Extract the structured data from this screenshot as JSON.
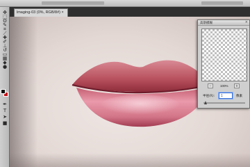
{
  "app": {
    "document_tab": "lmaging-03 (0%, RGB/8#) ×",
    "tab_close": "×"
  },
  "tools": [
    "move-tool-icon",
    "marquee-tool-icon",
    "lasso-tool-icon",
    "quick-select-icon",
    "crop-tool-icon",
    "eyedropper-icon",
    "healing-brush-icon",
    "brush-tool-icon",
    "clone-stamp-icon",
    "history-brush-icon",
    "eraser-icon",
    "gradient-icon",
    "blur-tool-icon",
    "dodge-tool-icon",
    "pen-tool-icon",
    "type-tool-icon",
    "path-select-icon",
    "shape-tool-icon"
  ],
  "colors": {
    "foreground": "#101010",
    "background": "#c4121a",
    "lip_upper": "#b8505d",
    "lip_lower": "#d8788a",
    "selection_accent": "#3a6fd1"
  },
  "panel": {
    "title": "高斯模糊",
    "close": "×",
    "zoom_out": "−",
    "zoom_in": "+",
    "zoom_value": "100%",
    "radius_label": "半径(R):",
    "radius_value": "1",
    "radius_unit": "像素",
    "radius_level": 0.05
  }
}
